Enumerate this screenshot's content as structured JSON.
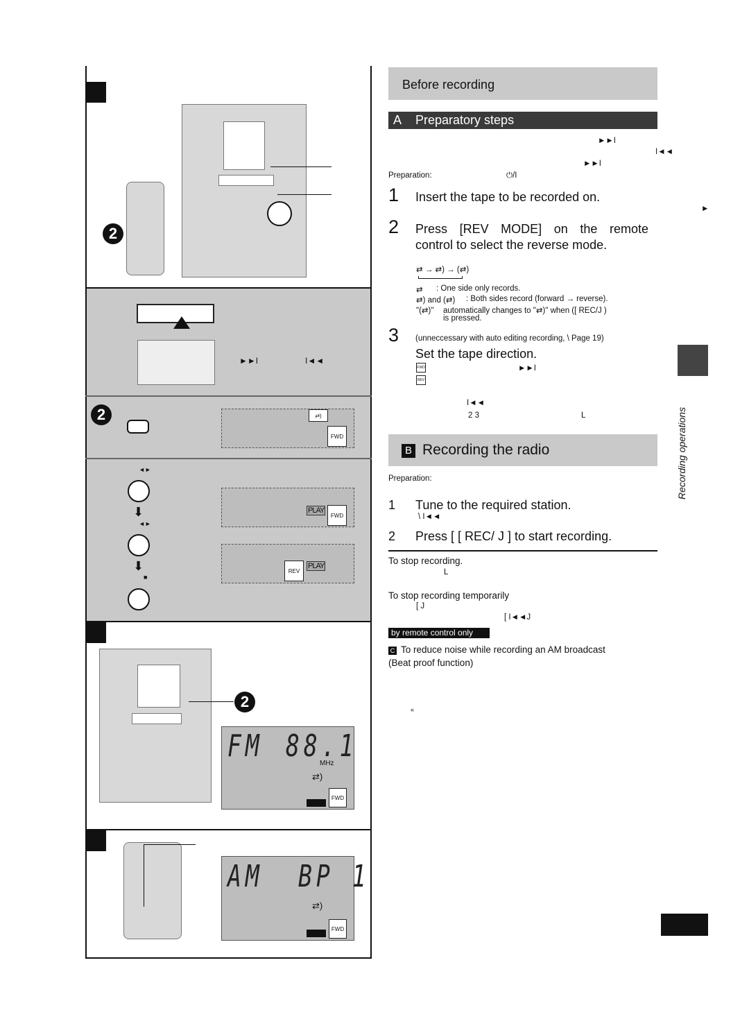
{
  "sections": {
    "before_recording": "Before recording",
    "a_letter": "A",
    "preparatory_steps": "Preparatory steps",
    "b_letter": "B",
    "recording_radio": "Recording the radio",
    "side_tab": "Recording operations"
  },
  "prep": {
    "symbols": [
      "►►I",
      "I◄◄",
      "►►I",
      "►"
    ],
    "preparation_label": "Preparation:",
    "power_symbol": "⏻/I",
    "step1_num": "1",
    "step1": "Insert the tape to be recorded on.",
    "step2_num": "2",
    "step2a": "Press [REV MODE] on the remote",
    "step2b": "control to select the reverse mode.",
    "mode_cycle": "⇄ → ⇄) → (⇄)",
    "mode1_sym": "⇄",
    "mode1": ":   One side only records.",
    "mode2_sym": "⇄) and (⇄)",
    "mode2": ":  Both sides record (forward → reverse).",
    "mode3_sym": "\"(⇄)\"",
    "mode3": "automatically changes to \"⇄)\" when ([  REC/J )",
    "mode3b": "is pressed.",
    "step3_num": "3",
    "step3_note": "(unneccessary with auto editing recording,      \\   Page 19)",
    "step3": "Set the tape direction.",
    "fwd": "FWD",
    "rev": "REV",
    "ff": "►►I",
    "rew": "I◄◄",
    "nums23": "2  3",
    "L": "L"
  },
  "radio": {
    "preparation_label": "Preparation:",
    "step1_num": "1",
    "step1": "Tune to the required station.",
    "step1_sub": "\\        I◄◄",
    "step2_num": "2",
    "step2": "Press [ [  REC/ J ] to start recording.",
    "stop_title": "To stop recording.",
    "stop_sub": "L",
    "pause_title": "To stop recording temporarily",
    "pause_sub1": "[          J",
    "pause_sub2": "[    I◄◄J",
    "remote_badge": "by remote control only",
    "c_letter": "C",
    "beat_title": "To reduce noise while recording an AM      broadcast",
    "beat_sub": "(Beat proof function)",
    "quote": "«"
  },
  "left": {
    "step_num": "2",
    "ff": "►►I",
    "rew": "I◄◄",
    "lr1": "◄►",
    "lr2": "◄►",
    "stop": "■",
    "play": "PLAY",
    "fwd": "FWD",
    "rev": "REV",
    "fm": "FM",
    "freq": "88.1",
    "mhz": "MHz",
    "am": "AM",
    "bp": "BP 1"
  }
}
